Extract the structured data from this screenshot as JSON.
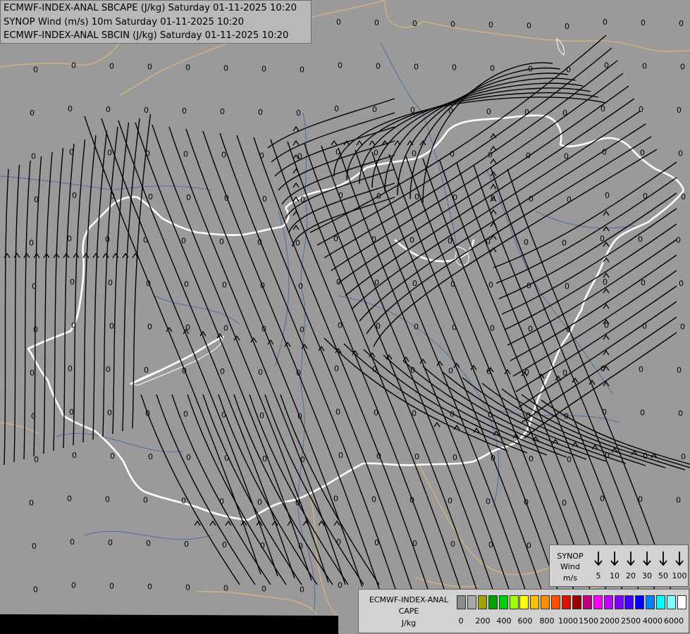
{
  "titles": {
    "line1": "ECMWF-INDEX-ANAL SBCAPE (J/kg) Saturday 01-11-2025 10:20",
    "line2": "SYNOP Wind (m/s) 10m Saturday 01-11-2025 10:20",
    "line3": "ECMWF-INDEX-ANAL SBCIN (J/kg) Saturday 01-11-2025 10:20"
  },
  "map": {
    "background_color": "#9a9a9a",
    "country_border_color": "#ffffff",
    "neighbor_border_color": "#d8b57a",
    "river_color": "#4f6f9a",
    "streamline_color": "#000000",
    "grid_value_label": "0"
  },
  "synop_legend": {
    "title_line1": "SYNOP",
    "title_line2": "Wind",
    "title_line3": "m/s",
    "speeds": [
      "5",
      "10",
      "20",
      "30",
      "50",
      "100"
    ]
  },
  "cape_legend": {
    "title_line1": "ECMWF-INDEX-ANAL",
    "title_line2": "CAPE",
    "title_line3": "J/kg",
    "colors": [
      "#8c8c8c",
      "#a8a8a8",
      "#a0a000",
      "#00a000",
      "#00d000",
      "#a0ff00",
      "#ffff00",
      "#ffc000",
      "#ff8c00",
      "#ff5000",
      "#e01000",
      "#a00000",
      "#c00080",
      "#ff00ff",
      "#c000ff",
      "#8000ff",
      "#4000ff",
      "#0000ff",
      "#0080ff",
      "#00ffff",
      "#80ffff",
      "#ffffff"
    ],
    "ticks": [
      "0",
      "200",
      "400",
      "600",
      "800",
      "1000",
      "1500",
      "2000",
      "2500",
      "4000",
      "6000"
    ]
  }
}
